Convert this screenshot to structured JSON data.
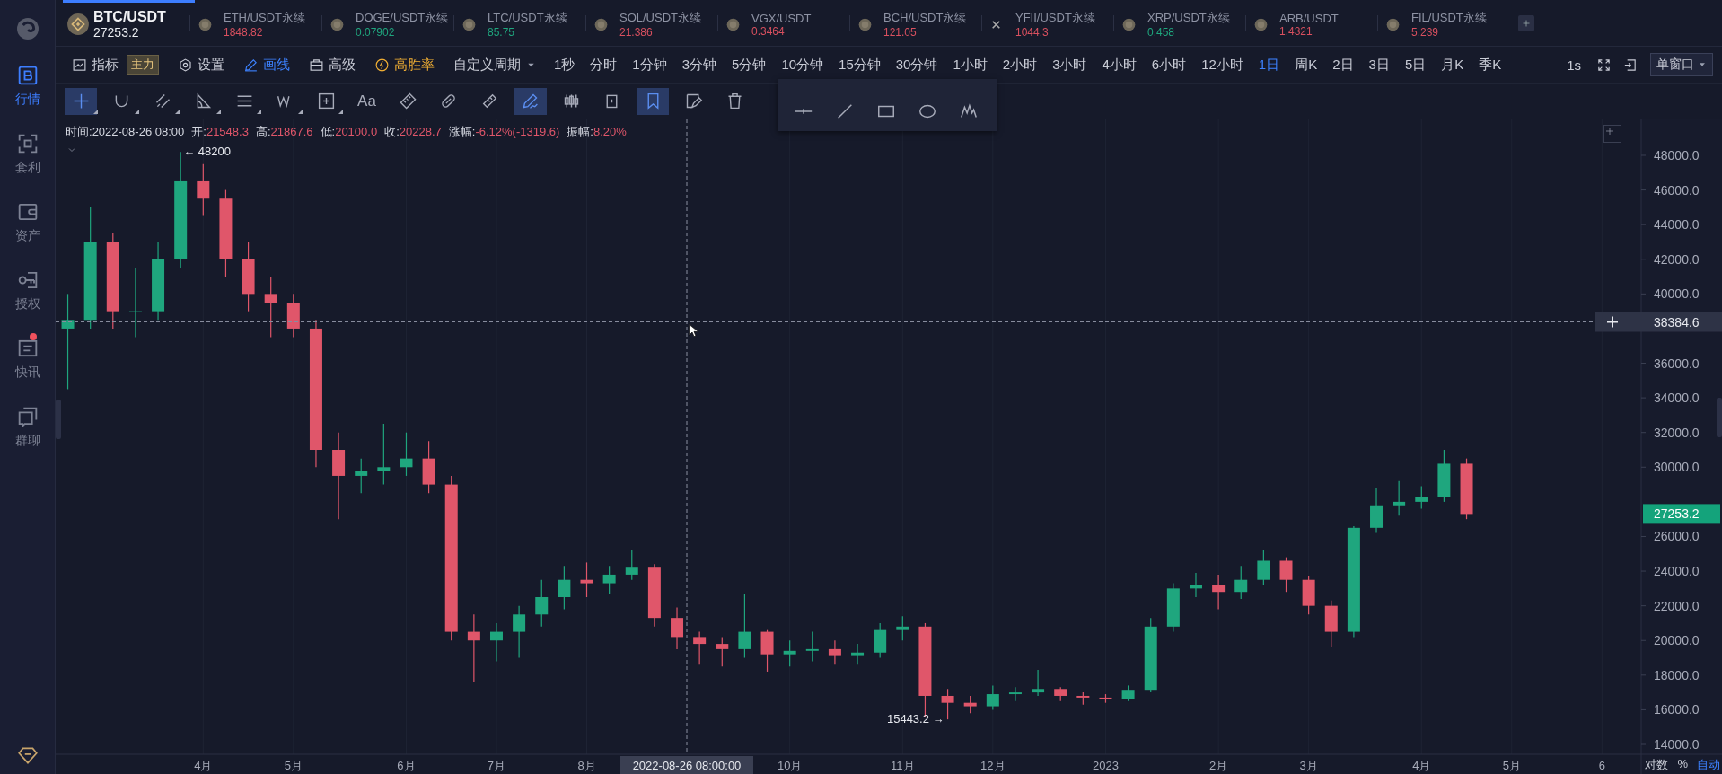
{
  "sidebar": {
    "items": [
      {
        "label": "行情",
        "selected": true,
        "notification": false
      },
      {
        "label": "套利",
        "selected": false,
        "notification": false
      },
      {
        "label": "资产",
        "selected": false,
        "notification": false
      },
      {
        "label": "授权",
        "selected": false,
        "notification": false
      },
      {
        "label": "快讯",
        "selected": false,
        "notification": true
      },
      {
        "label": "群聊",
        "selected": false,
        "notification": false
      }
    ]
  },
  "symbol_tabs": [
    {
      "symbol": "BTC/USDT",
      "price": "27253.2",
      "color": "#eceef2",
      "selected": true
    },
    {
      "symbol": "ETH/USDT永续",
      "price": "1848.82",
      "color": "#d8505f",
      "selected": false
    },
    {
      "symbol": "DOGE/USDT永续",
      "price": "0.07902",
      "color": "#1fa67e",
      "selected": false
    },
    {
      "symbol": "LTC/USDT永续",
      "price": "85.75",
      "color": "#1fa67e",
      "selected": false
    },
    {
      "symbol": "SOL/USDT永续",
      "price": "21.386",
      "color": "#d8505f",
      "selected": false
    },
    {
      "symbol": "VGX/USDT",
      "price": "0.3464",
      "color": "#d8505f",
      "selected": false
    },
    {
      "symbol": "BCH/USDT永续",
      "price": "121.05",
      "color": "#d8505f",
      "selected": false
    },
    {
      "symbol": "YFII/USDT永续",
      "price": "1044.3",
      "color": "#d8505f",
      "selected": false
    },
    {
      "symbol": "XRP/USDT永续",
      "price": "0.458",
      "color": "#1fa67e",
      "selected": false
    },
    {
      "symbol": "ARB/USDT",
      "price": "1.4321",
      "color": "#d8505f",
      "selected": false
    },
    {
      "symbol": "FIL/USDT永续",
      "price": "5.239",
      "color": "#d8505f",
      "selected": false
    }
  ],
  "toolbar": {
    "items": [
      {
        "label": "指标",
        "badge": "主力",
        "active": false,
        "featured": false
      },
      {
        "label": "设置",
        "active": false,
        "featured": false
      },
      {
        "label": "画线",
        "active": true,
        "featured": false
      },
      {
        "label": "高级",
        "active": false,
        "featured": false
      },
      {
        "label": "高胜率",
        "active": false,
        "featured": true
      }
    ],
    "custom_period": "自定义周期",
    "periods": [
      {
        "label": "1秒",
        "selected": false
      },
      {
        "label": "分时",
        "selected": false
      },
      {
        "label": "1分钟",
        "selected": false
      },
      {
        "label": "3分钟",
        "selected": false
      },
      {
        "label": "5分钟",
        "selected": false
      },
      {
        "label": "10分钟",
        "selected": false
      },
      {
        "label": "15分钟",
        "selected": false
      },
      {
        "label": "30分钟",
        "selected": false
      },
      {
        "label": "1小时",
        "selected": false
      },
      {
        "label": "2小时",
        "selected": false
      },
      {
        "label": "3小时",
        "selected": false
      },
      {
        "label": "4小时",
        "selected": false
      },
      {
        "label": "6小时",
        "selected": false
      },
      {
        "label": "12小时",
        "selected": false
      },
      {
        "label": "1日",
        "selected": true
      },
      {
        "label": "周K",
        "selected": false
      },
      {
        "label": "2日",
        "selected": false
      },
      {
        "label": "3日",
        "selected": false
      },
      {
        "label": "5日",
        "selected": false
      },
      {
        "label": "月K",
        "selected": false
      },
      {
        "label": "季K",
        "selected": false
      }
    ],
    "interval": "1s",
    "layout": "单窗口"
  },
  "drawing_tools": [
    {
      "selected": true,
      "has_menu": true
    },
    {
      "selected": false,
      "has_menu": true
    },
    {
      "selected": false,
      "has_menu": true
    },
    {
      "selected": false,
      "has_menu": true
    },
    {
      "selected": false,
      "has_menu": true
    },
    {
      "selected": false,
      "has_menu": true
    },
    {
      "selected": false,
      "has_menu": true
    },
    {
      "label": "Aa",
      "selected": false,
      "has_menu": false
    },
    {
      "selected": false,
      "has_menu": false
    },
    {
      "selected": false,
      "has_menu": false
    },
    {
      "selected": false,
      "has_menu": false
    },
    {
      "selected": true,
      "has_menu": false
    },
    {
      "selected": false,
      "has_menu": false
    },
    {
      "selected": false,
      "has_menu": false
    },
    {
      "selected": true,
      "has_menu": false
    },
    {
      "selected": false,
      "has_menu": false
    },
    {
      "selected": false,
      "has_menu": false
    }
  ],
  "ohlc": [
    {
      "label": "时间:",
      "value": "2022-08-26 08:00",
      "color": "#d4d7e0"
    },
    {
      "label": "开:",
      "value": "21548.3",
      "color": "#e0566a"
    },
    {
      "label": "高:",
      "value": "21867.6",
      "color": "#e0566a"
    },
    {
      "label": "低:",
      "value": "20100.0",
      "color": "#e0566a"
    },
    {
      "label": "收:",
      "value": "20228.7",
      "color": "#e0566a"
    },
    {
      "label": "涨幅:",
      "value": "-6.12%(-1319.6)",
      "color": "#e0566a"
    },
    {
      "label": "振幅:",
      "value": "8.20%",
      "color": "#e0566a"
    }
  ],
  "chart": {
    "chart_data": {
      "type": "candlestick",
      "grid": true,
      "ref_lines": [
        {
          "axis": "y",
          "value": 38384.6
        }
      ],
      "categories": [
        null,
        null,
        null,
        null,
        null,
        null,
        "4月",
        null,
        null,
        null,
        "5月",
        null,
        null,
        null,
        null,
        "6月",
        null,
        null,
        null,
        "7月",
        null,
        null,
        null,
        "8月",
        null,
        null,
        null,
        null,
        null,
        null,
        null,
        null,
        "10月",
        null,
        null,
        null,
        null,
        "11月",
        null,
        null,
        null,
        "12月",
        null,
        null,
        null,
        null,
        "2023",
        null,
        null,
        null,
        null,
        "2月",
        null,
        null,
        null,
        "3月",
        null,
        null,
        null,
        null,
        "4月",
        null,
        null,
        null,
        "5月",
        null,
        null,
        null,
        "6"
      ],
      "ylim": [
        13430,
        50073
      ],
      "yticks": [
        {
          "value": 48000,
          "label": "48000.0"
        },
        {
          "value": 46000,
          "label": "46000.0"
        },
        {
          "value": 44000,
          "label": "44000.0"
        },
        {
          "value": 42000,
          "label": "42000.0"
        },
        {
          "value": 40000,
          "label": "40000.0"
        },
        {
          "value": 36000,
          "label": "36000.0"
        },
        {
          "value": 34000,
          "label": "34000.0"
        },
        {
          "value": 32000,
          "label": "32000.0"
        },
        {
          "value": 30000,
          "label": "30000.0"
        },
        {
          "value": 26000,
          "label": "26000.0"
        },
        {
          "value": 24000,
          "label": "24000.0"
        },
        {
          "value": 22000,
          "label": "22000.0"
        },
        {
          "value": 20000,
          "label": "20000.0"
        },
        {
          "value": 18000,
          "label": "18000.0"
        },
        {
          "value": 16000,
          "label": "16000.0"
        },
        {
          "value": 14000,
          "label": "14000.0"
        }
      ],
      "ohlc": [
        [
          38000,
          40000,
          34500,
          38500
        ],
        [
          38500,
          45000,
          38000,
          43000
        ],
        [
          43000,
          43500,
          38000,
          39000
        ],
        [
          39000,
          41500,
          37500,
          39000
        ],
        [
          39000,
          43000,
          38500,
          42000
        ],
        [
          42000,
          48200,
          41500,
          46500
        ],
        [
          46500,
          47500,
          44500,
          45500
        ],
        [
          45500,
          46000,
          41000,
          42000
        ],
        [
          42000,
          43000,
          39000,
          40000
        ],
        [
          40000,
          41000,
          37500,
          39500
        ],
        [
          39500,
          40000,
          37500,
          38000
        ],
        [
          38000,
          38500,
          30000,
          31000
        ],
        [
          31000,
          32000,
          27000,
          29500
        ],
        [
          29500,
          30500,
          28500,
          29800
        ],
        [
          29800,
          32500,
          29000,
          30000
        ],
        [
          30000,
          32000,
          29500,
          30500
        ],
        [
          30500,
          31500,
          28500,
          29000
        ],
        [
          29000,
          29500,
          20000,
          20500
        ],
        [
          20500,
          21500,
          17600,
          20000
        ],
        [
          20000,
          21000,
          18800,
          20500
        ],
        [
          20500,
          22000,
          19000,
          21500
        ],
        [
          21500,
          23500,
          20800,
          22500
        ],
        [
          22500,
          24300,
          21800,
          23500
        ],
        [
          23500,
          24500,
          22500,
          23300
        ],
        [
          23300,
          24300,
          22700,
          23800
        ],
        [
          23800,
          25200,
          23500,
          24200
        ],
        [
          24200,
          24400,
          20800,
          21300
        ],
        [
          21300,
          21900,
          19500,
          20200
        ],
        [
          20200,
          20500,
          18600,
          19800
        ],
        [
          19800,
          20200,
          18500,
          19500
        ],
        [
          19500,
          22700,
          19000,
          20500
        ],
        [
          20500,
          20600,
          18200,
          19200
        ],
        [
          19200,
          20000,
          18500,
          19400
        ],
        [
          19400,
          20500,
          18800,
          19500
        ],
        [
          19500,
          20000,
          18600,
          19100
        ],
        [
          19100,
          19800,
          18600,
          19300
        ],
        [
          19300,
          21000,
          19000,
          20600
        ],
        [
          20600,
          21400,
          20000,
          20800
        ],
        [
          20800,
          21000,
          15600,
          16800
        ],
        [
          16800,
          17200,
          15443,
          16400
        ],
        [
          16400,
          16800,
          15800,
          16200
        ],
        [
          16200,
          17400,
          16000,
          16900
        ],
        [
          16900,
          17300,
          16500,
          17000
        ],
        [
          17000,
          18300,
          16800,
          17200
        ],
        [
          17200,
          17300,
          16500,
          16800
        ],
        [
          16800,
          17000,
          16300,
          16700
        ],
        [
          16700,
          16900,
          16400,
          16600
        ],
        [
          16600,
          17400,
          16500,
          17100
        ],
        [
          17100,
          21300,
          17000,
          20800
        ],
        [
          20800,
          23300,
          20500,
          23000
        ],
        [
          23000,
          23900,
          22500,
          23200
        ],
        [
          23200,
          23800,
          21800,
          22800
        ],
        [
          22800,
          24300,
          22400,
          23500
        ],
        [
          23500,
          25200,
          23200,
          24600
        ],
        [
          24600,
          24800,
          22800,
          23500
        ],
        [
          23500,
          23700,
          21500,
          22000
        ],
        [
          22000,
          22300,
          19600,
          20500
        ],
        [
          20500,
          26600,
          20200,
          26500
        ],
        [
          26500,
          28800,
          26200,
          27800
        ],
        [
          27800,
          29200,
          27200,
          28000
        ],
        [
          28000,
          28900,
          27600,
          28300
        ],
        [
          28300,
          31000,
          28000,
          30200
        ],
        [
          30200,
          30500,
          27000,
          27300
        ],
        null,
        null,
        null,
        null,
        null,
        null
      ],
      "annotations": [
        "← 48200",
        "15443.2 →"
      ]
    },
    "crosshair": {
      "time": "2022-08-26 08:00:00",
      "price": "38384.6"
    },
    "last_price": "27253.2",
    "scale_buttons": [
      {
        "label": "对数",
        "selected": false
      },
      {
        "label": "%",
        "selected": false
      },
      {
        "label": "自动",
        "selected": true
      }
    ]
  }
}
